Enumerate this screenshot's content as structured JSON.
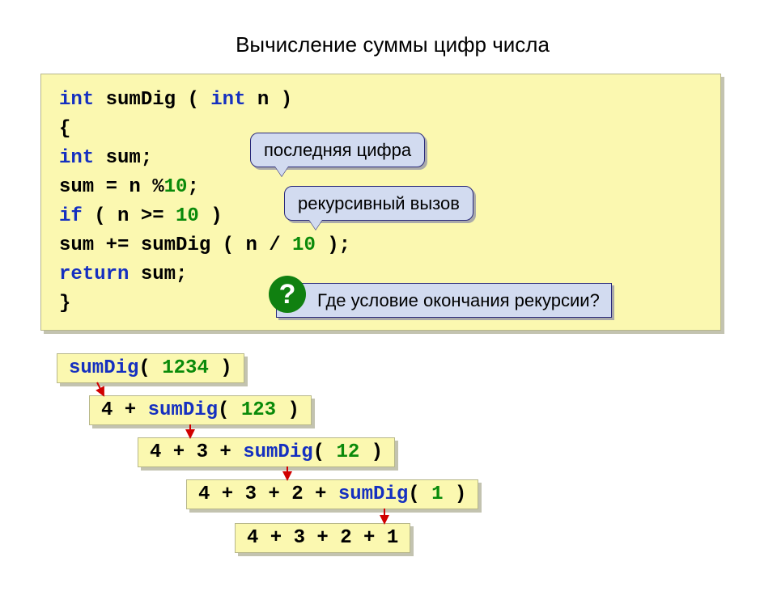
{
  "title": "Вычисление суммы цифр числа",
  "code": {
    "l1": {
      "kw_int": "int",
      "fn": "sumDig",
      "open": " ( ",
      "kw_int2": "int",
      "n": " n )"
    },
    "l2": "{",
    "l3": {
      "indent": "  ",
      "kw_int": "int",
      "rest": " sum;"
    },
    "l4": {
      "indent": "  ",
      "text": "sum = n %",
      "num": "10",
      "semi": ";"
    },
    "l5": {
      "indent": "  ",
      "kw_if": "if",
      "open": " ( n >= ",
      "num": "10",
      "close": " )"
    },
    "l6": {
      "indent": "   ",
      "text": "sum += sumDig ( n / ",
      "num": "10",
      "close": " );"
    },
    "l7": {
      "indent": "  ",
      "kw_return": "return",
      "rest": " sum;"
    },
    "l8": "}"
  },
  "callouts": {
    "last_digit": "последняя цифра",
    "recursive_call": "рекурсивный вызов",
    "question": "Где условие окончания рекурсии?",
    "qmark": "?"
  },
  "trace": {
    "t1a": "sumDig",
    "t1b": "( ",
    "t1n": "1234",
    "t1c": " )",
    "t2a": "4 + ",
    "t2b": "sumDig",
    "t2c": "( ",
    "t2n": "123",
    "t2d": " )",
    "t3a": "4 + 3 + ",
    "t3b": "sumDig",
    "t3c": "( ",
    "t3n": "12",
    "t3d": " )",
    "t4a": "4 + 3 + 2 + ",
    "t4b": "sumDig",
    "t4c": "( ",
    "t4n": "1",
    "t4d": " )",
    "t5": "4 + 3 + 2 + 1"
  }
}
